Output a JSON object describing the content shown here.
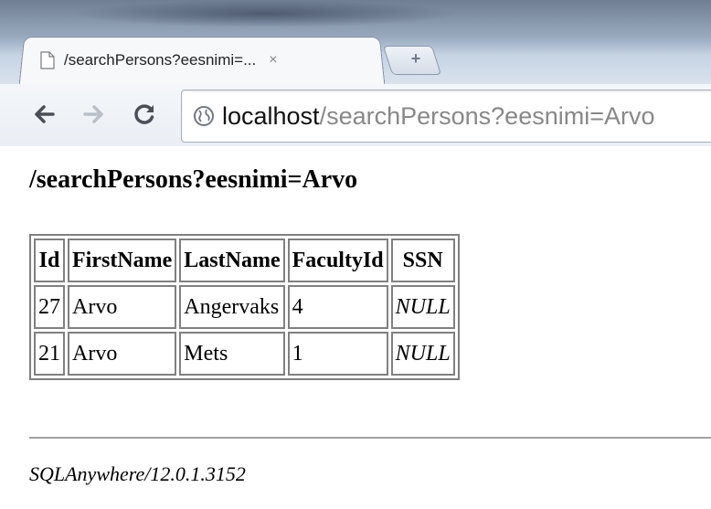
{
  "browser": {
    "tab_title": "/searchPersons?eesnimi=...",
    "tab_close": "×",
    "newtab_symbol": "+",
    "url_host": "localhost",
    "url_path": "/searchPersons?eesnimi=Arvo",
    "icons": {
      "back": "back-arrow-icon",
      "forward": "forward-arrow-icon",
      "reload": "reload-icon",
      "page": "page-icon",
      "globe": "globe-icon"
    }
  },
  "page": {
    "heading": "/searchPersons?eesnimi=Arvo",
    "table": {
      "columns": [
        "Id",
        "FirstName",
        "LastName",
        "FacultyId",
        "SSN"
      ],
      "rows": [
        [
          "27",
          "Arvo",
          "Angervaks",
          "4",
          "NULL"
        ],
        [
          "21",
          "Arvo",
          "Mets",
          "1",
          "NULL"
        ]
      ]
    },
    "footer": "SQLAnywhere/12.0.1.3152"
  }
}
